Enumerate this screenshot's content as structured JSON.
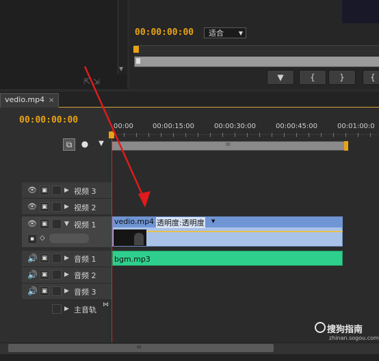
{
  "program_monitor": {
    "timecode": "00:00:00:00",
    "fit_select": "适合"
  },
  "controls": {
    "btn1": "▼",
    "btn2": "{",
    "btn3": "}",
    "btn4": "{"
  },
  "sequence_tab": {
    "label": "vedio.mp4",
    "close": "×"
  },
  "timeline": {
    "timecode": "00:00:00:00",
    "ruler_labels": [
      "00:00",
      "00:00:15:00",
      "00:00:30:00",
      "00:00:45:00",
      "00:01:00:0"
    ],
    "work_bar_marker": "III",
    "scroll_marker": "III"
  },
  "tracks": {
    "video3": "视频 3",
    "video2": "视频 2",
    "video1": "视频 1",
    "audio1": "音频 1",
    "audio2": "音频 2",
    "audio3": "音频 3",
    "master": "主音轨"
  },
  "clips": {
    "video_name": "vedio.mp4",
    "video_effect": "透明度:透明度",
    "audio_name": "bgm.mp3"
  },
  "watermark": {
    "brand": "搜狗指南",
    "url": "zhinan.sogou.com"
  },
  "colors": {
    "timecode": "#e8a317",
    "video_clip": "#a9c2e8",
    "audio_clip": "#2ecf8c",
    "playhead": "#d42a2a",
    "annotation_arrow": "#e01b1b"
  }
}
